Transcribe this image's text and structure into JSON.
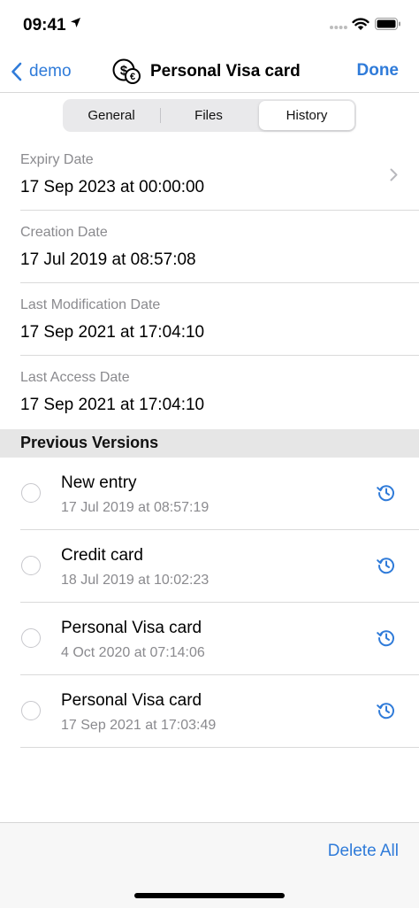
{
  "status_bar": {
    "time": "09:41"
  },
  "nav": {
    "back_label": "demo",
    "title": "Personal Visa card",
    "done_label": "Done"
  },
  "tabs": [
    {
      "label": "General",
      "selected": false
    },
    {
      "label": "Files",
      "selected": false
    },
    {
      "label": "History",
      "selected": true
    }
  ],
  "fields": [
    {
      "label": "Expiry Date",
      "value": "17 Sep 2023 at 00:00:00"
    },
    {
      "label": "Creation Date",
      "value": "17 Jul 2019 at 08:57:08"
    },
    {
      "label": "Last Modification Date",
      "value": "17 Sep 2021 at 17:04:10"
    },
    {
      "label": "Last Access Date",
      "value": "17 Sep 2021 at 17:04:10"
    }
  ],
  "versions_section": {
    "title": "Previous Versions",
    "items": [
      {
        "title": "New entry",
        "date": "17 Jul 2019 at 08:57:19"
      },
      {
        "title": "Credit card",
        "date": "18 Jul 2019 at 10:02:23"
      },
      {
        "title": "Personal Visa card",
        "date": "4 Oct 2020 at 07:14:06"
      },
      {
        "title": "Personal Visa card",
        "date": "17 Sep 2021 at 17:03:49"
      }
    ]
  },
  "toolbar": {
    "delete_all_label": "Delete All"
  },
  "icons": {
    "back": "chevron-left-icon",
    "entry": "dollar-euro-coins-icon",
    "expiry_action": "chevron-right-icon",
    "restore": "clock-history-icon"
  },
  "colors": {
    "accent": "#2f7bd9",
    "secondary_text": "#8a8a8e",
    "section_background": "#e6e6e6"
  }
}
